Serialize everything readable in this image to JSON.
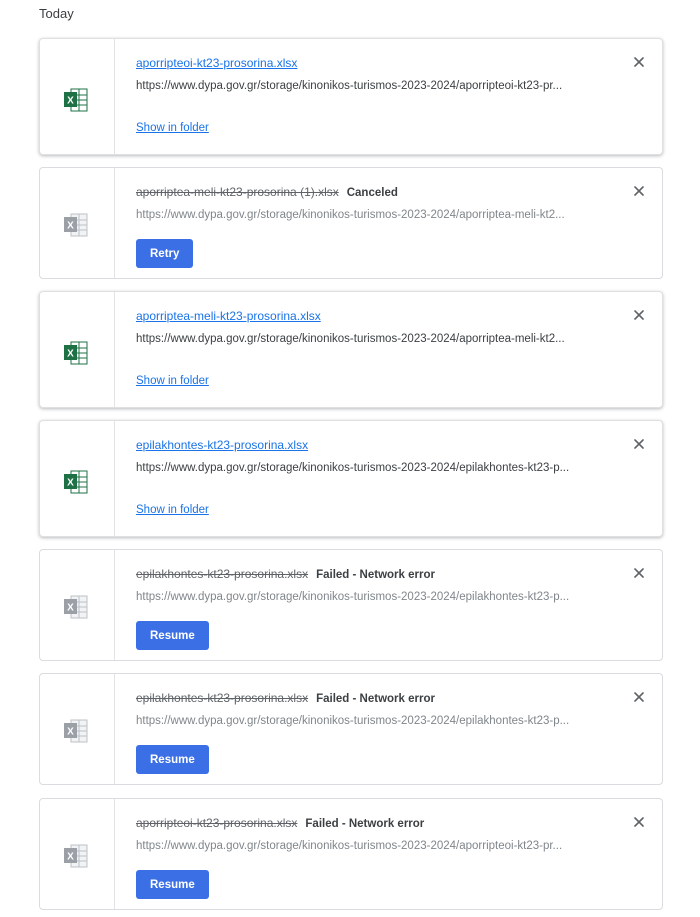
{
  "section_title": "Today",
  "colors": {
    "accent": "#1a73e8",
    "button": "#3b6fe6"
  },
  "downloads": [
    {
      "filename": "aporripteoi-kt23-prosorina.xlsx",
      "state": "complete",
      "url": "https://www.dypa.gov.gr/storage/kinonikos-turismos-2023-2024/aporripteoi-kt23-pr...",
      "action_label": "Show in folder",
      "icon": "excel-file-icon"
    },
    {
      "filename": "aporriptea-meli-kt23-prosorina (1).xlsx",
      "state": "canceled",
      "status": "Canceled",
      "url": "https://www.dypa.gov.gr/storage/kinonikos-turismos-2023-2024/aporriptea-meli-kt2...",
      "action_label": "Retry",
      "icon": "excel-file-icon-disabled"
    },
    {
      "filename": "aporriptea-meli-kt23-prosorina.xlsx",
      "state": "complete",
      "url": "https://www.dypa.gov.gr/storage/kinonikos-turismos-2023-2024/aporriptea-meli-kt2...",
      "action_label": "Show in folder",
      "icon": "excel-file-icon"
    },
    {
      "filename": "epilakhontes-kt23-prosorina.xlsx",
      "state": "complete",
      "url": "https://www.dypa.gov.gr/storage/kinonikos-turismos-2023-2024/epilakhontes-kt23-p...",
      "action_label": "Show in folder",
      "icon": "excel-file-icon"
    },
    {
      "filename": "epilakhontes-kt23-prosorina.xlsx",
      "state": "failed",
      "status": "Failed - Network error",
      "url": "https://www.dypa.gov.gr/storage/kinonikos-turismos-2023-2024/epilakhontes-kt23-p...",
      "action_label": "Resume",
      "icon": "excel-file-icon-disabled"
    },
    {
      "filename": "epilakhontes-kt23-prosorina.xlsx",
      "state": "failed",
      "status": "Failed - Network error",
      "url": "https://www.dypa.gov.gr/storage/kinonikos-turismos-2023-2024/epilakhontes-kt23-p...",
      "action_label": "Resume",
      "icon": "excel-file-icon-disabled"
    },
    {
      "filename": "aporripteoi-kt23-prosorina.xlsx",
      "state": "failed",
      "status": "Failed - Network error",
      "url": "https://www.dypa.gov.gr/storage/kinonikos-turismos-2023-2024/aporripteoi-kt23-pr...",
      "action_label": "Resume",
      "icon": "excel-file-icon-disabled"
    }
  ]
}
